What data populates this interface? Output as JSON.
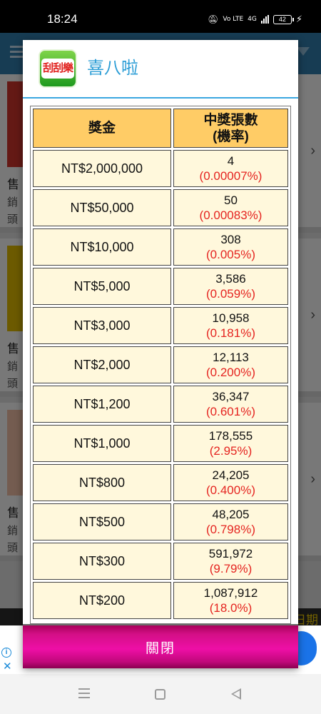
{
  "status_bar": {
    "time": "18:24",
    "network": "4G",
    "volte": "Vo LTE",
    "battery": "42"
  },
  "background": {
    "cards": [
      {
        "title": "售",
        "line1": "銷",
        "line2": "頭"
      },
      {
        "title": "售",
        "line1": "銷",
        "line2": "頭"
      },
      {
        "title": "售",
        "line1": "銷",
        "line2": "頭"
      }
    ],
    "footer_text": "日期"
  },
  "dialog": {
    "title": "喜八啦",
    "logo_text": "刮刮樂",
    "table": {
      "headers": {
        "prize": "獎金",
        "count_line1": "中獎張數",
        "count_line2": "(機率)"
      },
      "rows": [
        {
          "prize": "NT$2,000,000",
          "count": "4",
          "probability": "(0.00007%)"
        },
        {
          "prize": "NT$50,000",
          "count": "50",
          "probability": "(0.00083%)"
        },
        {
          "prize": "NT$10,000",
          "count": "308",
          "probability": "(0.005%)"
        },
        {
          "prize": "NT$5,000",
          "count": "3,586",
          "probability": "(0.059%)"
        },
        {
          "prize": "NT$3,000",
          "count": "10,958",
          "probability": "(0.181%)"
        },
        {
          "prize": "NT$2,000",
          "count": "12,113",
          "probability": "(0.200%)"
        },
        {
          "prize": "NT$1,200",
          "count": "36,347",
          "probability": "(0.601%)"
        },
        {
          "prize": "NT$1,000",
          "count": "178,555",
          "probability": "(2.95%)"
        },
        {
          "prize": "NT$800",
          "count": "24,205",
          "probability": "(0.400%)"
        },
        {
          "prize": "NT$500",
          "count": "48,205",
          "probability": "(0.798%)"
        },
        {
          "prize": "NT$300",
          "count": "591,972",
          "probability": "(9.79%)"
        },
        {
          "prize": "NT$200",
          "count": "1,087,912",
          "probability": "(18.0%)"
        }
      ]
    },
    "close_label": "關閉"
  },
  "colors": {
    "accent_blue": "#2b9dd6",
    "header_cell": "#ffcc66",
    "body_cell": "#fff8dc",
    "probability_red": "#e52420",
    "close_button": "#e00c98"
  }
}
